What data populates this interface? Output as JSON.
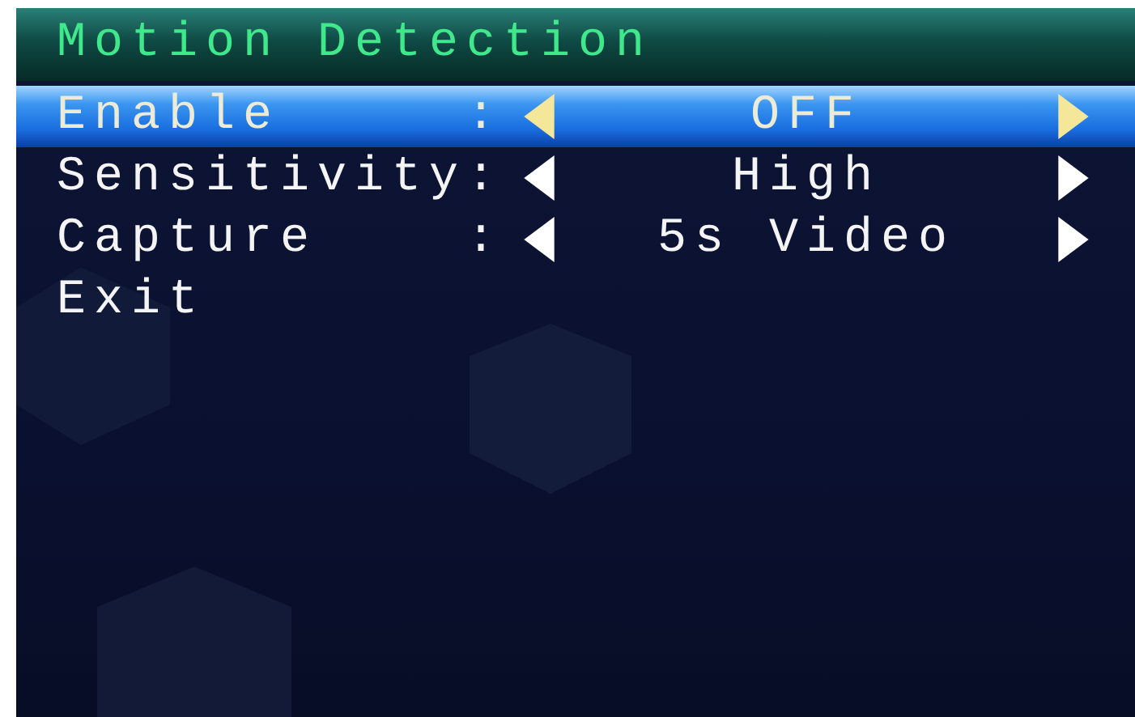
{
  "title": "Motion Detection",
  "items": [
    {
      "kind": "option",
      "label": "Enable",
      "separator": ":",
      "value": "OFF",
      "selected": true
    },
    {
      "kind": "option",
      "label": "Sensitivity",
      "separator": ":",
      "value": "High",
      "selected": false
    },
    {
      "kind": "option",
      "label": "Capture",
      "separator": ":",
      "value": "5s Video",
      "selected": false
    },
    {
      "kind": "action",
      "label": "Exit",
      "selected": false
    }
  ]
}
